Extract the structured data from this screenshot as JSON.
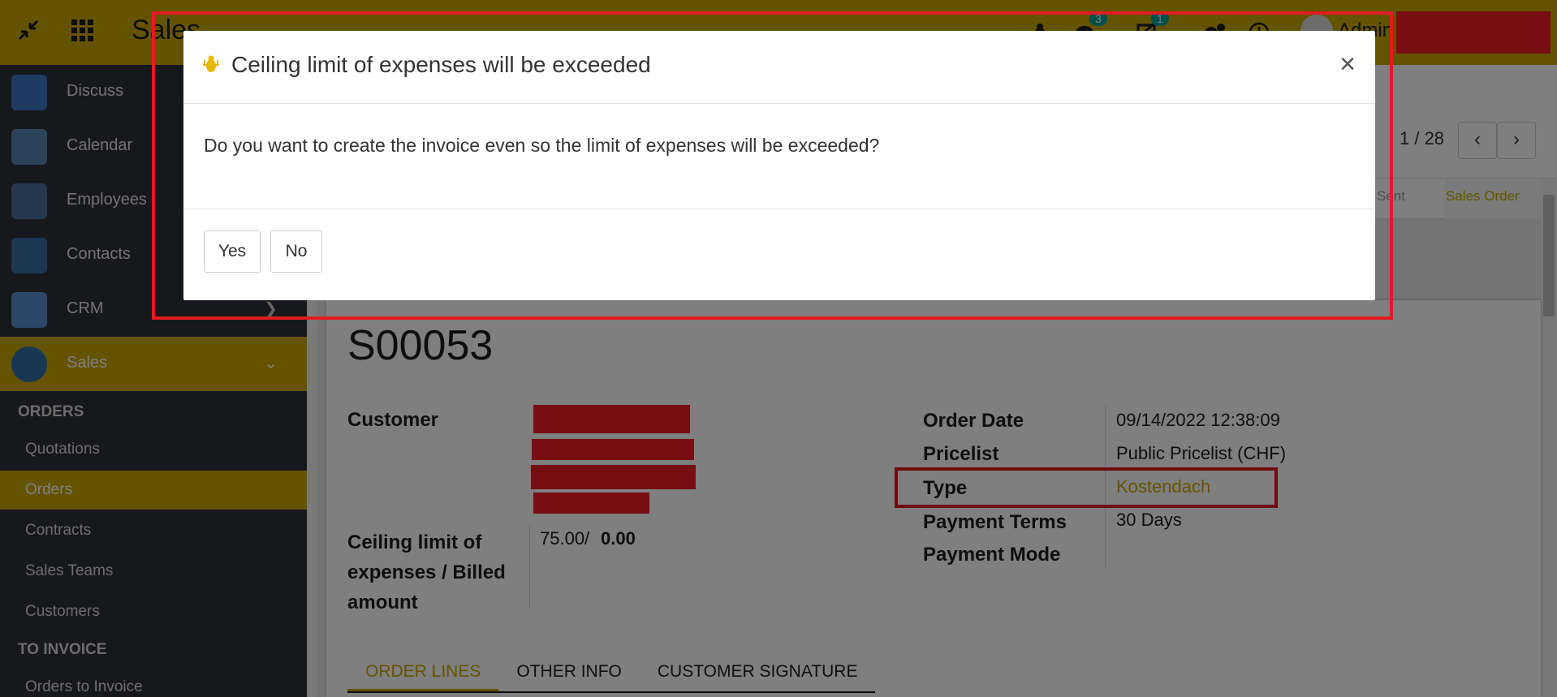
{
  "navbar": {
    "app_title": "Sales",
    "user_name": "Admin",
    "messages_count": "3",
    "activities_count": "1"
  },
  "sidebar": {
    "apps": [
      {
        "label": "Discuss"
      },
      {
        "label": "Calendar"
      },
      {
        "label": "Employees"
      },
      {
        "label": "Contacts"
      },
      {
        "label": "CRM"
      },
      {
        "label": "Sales"
      }
    ],
    "sections": [
      {
        "header": "ORDERS",
        "items": [
          "Quotations",
          "Orders",
          "Contracts",
          "Sales Teams",
          "Customers"
        ]
      },
      {
        "header": "TO INVOICE",
        "items": [
          "Orders to Invoice"
        ]
      }
    ]
  },
  "pager": {
    "value": "1 / 28"
  },
  "status": {
    "stage_sent": "Sent",
    "stage_order": "Sales Order"
  },
  "record": {
    "name": "S00053",
    "customer_label": "Customer",
    "ceiling_label": "Ceiling limit of expenses / Billed amount",
    "ceiling_value": "75.00/",
    "billed_value": "0.00",
    "order_date_label": "Order Date",
    "order_date": "09/14/2022 12:38:09",
    "pricelist_label": "Pricelist",
    "pricelist": "Public Pricelist (CHF)",
    "type_label": "Type",
    "type": "Kostendach",
    "payment_terms_label": "Payment Terms",
    "payment_terms": "30 Days",
    "payment_mode_label": "Payment Mode"
  },
  "tabs": [
    "ORDER LINES",
    "OTHER INFO",
    "CUSTOMER SIGNATURE"
  ],
  "modal": {
    "title": "Ceiling limit of expenses will be exceeded",
    "message": "Do you want to create the invoice even so the limit of expenses will be exceeded?",
    "yes_label": "Yes",
    "no_label": "No",
    "close_symbol": "×"
  },
  "colors": {
    "accent": "#c9a700",
    "sidebar": "#2e3138",
    "annotation": "#e11b22",
    "redaction": "#ec1c24"
  }
}
